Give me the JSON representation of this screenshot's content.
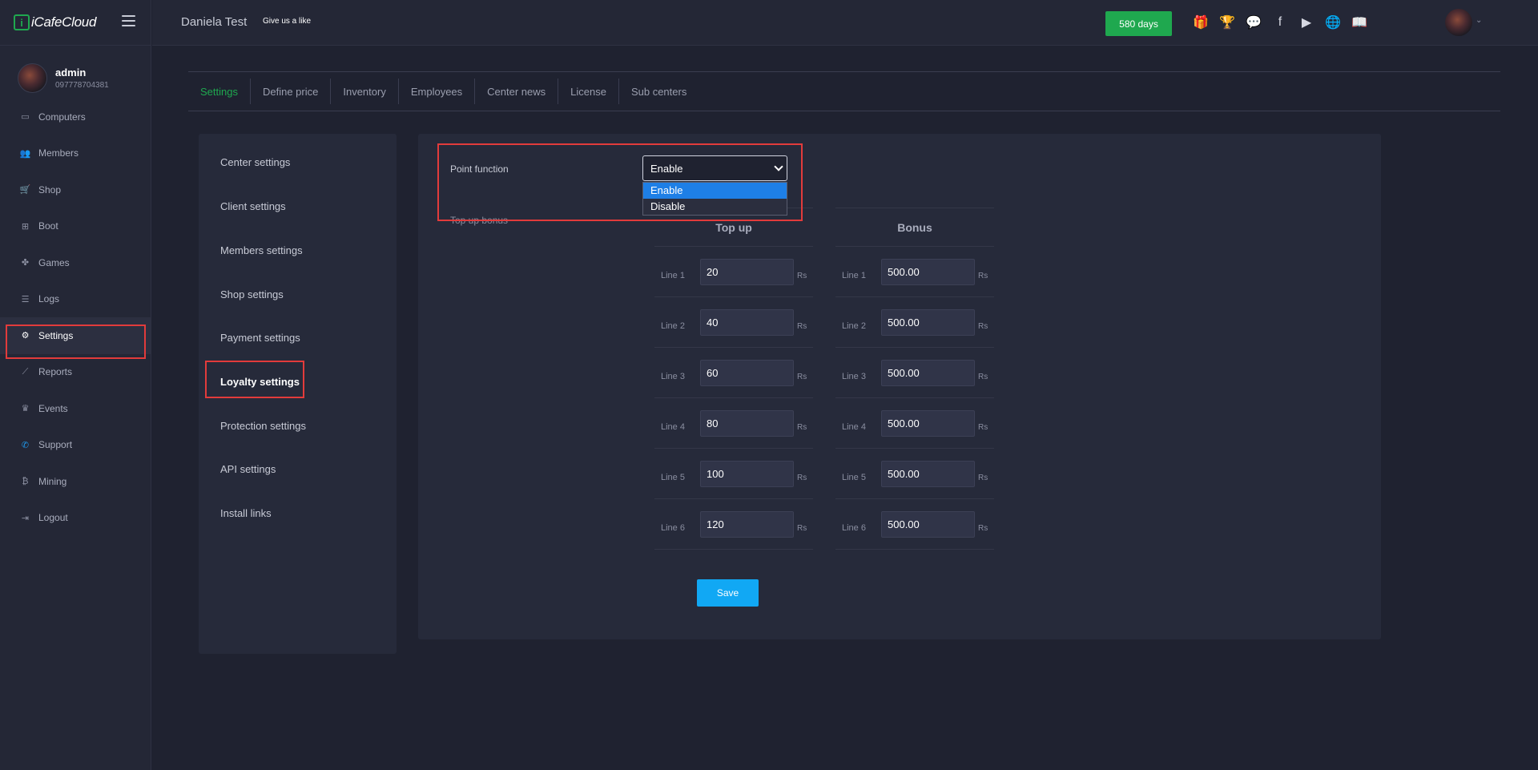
{
  "app": {
    "logo_text": "iCafeCloud",
    "logo_mark": "i"
  },
  "user": {
    "name": "admin",
    "phone": "097778704381"
  },
  "sidebar": {
    "items": [
      {
        "label": "Computers",
        "icon": "monitor-icon",
        "glyph": "▭"
      },
      {
        "label": "Members",
        "icon": "users-icon",
        "glyph": "👥"
      },
      {
        "label": "Shop",
        "icon": "cart-icon",
        "glyph": "🛒"
      },
      {
        "label": "Boot",
        "icon": "windows-icon",
        "glyph": "⊞"
      },
      {
        "label": "Games",
        "icon": "gamepad-icon",
        "glyph": "✤"
      },
      {
        "label": "Logs",
        "icon": "list-icon",
        "glyph": "☰"
      },
      {
        "label": "Settings",
        "icon": "gear-icon",
        "glyph": "⚙"
      },
      {
        "label": "Reports",
        "icon": "chart-icon",
        "glyph": "⟋"
      },
      {
        "label": "Events",
        "icon": "crown-icon",
        "glyph": "♛"
      },
      {
        "label": "Support",
        "icon": "phone-icon",
        "glyph": "✆"
      },
      {
        "label": "Mining",
        "icon": "bitcoin-icon",
        "glyph": "₿"
      },
      {
        "label": "Logout",
        "icon": "logout-icon",
        "glyph": "⇥"
      }
    ],
    "active_index": 6
  },
  "header": {
    "center_name": "Daniela Test",
    "give_like": "Give us a like",
    "days_badge": "580 days",
    "icons": [
      {
        "name": "gift-icon",
        "glyph": "🎁"
      },
      {
        "name": "trophy-icon",
        "glyph": "🏆"
      },
      {
        "name": "discord-icon",
        "glyph": "💬"
      },
      {
        "name": "facebook-icon",
        "glyph": "f"
      },
      {
        "name": "youtube-icon",
        "glyph": "▶"
      },
      {
        "name": "globe-icon",
        "glyph": "🌐"
      },
      {
        "name": "book-icon",
        "glyph": "📖"
      }
    ]
  },
  "tabs": [
    {
      "label": "Settings",
      "active": true
    },
    {
      "label": "Define price"
    },
    {
      "label": "Inventory"
    },
    {
      "label": "Employees"
    },
    {
      "label": "Center news"
    },
    {
      "label": "License"
    },
    {
      "label": "Sub centers"
    }
  ],
  "settings_menu": [
    {
      "label": "Center settings"
    },
    {
      "label": "Client settings"
    },
    {
      "label": "Members settings"
    },
    {
      "label": "Shop settings"
    },
    {
      "label": "Payment settings"
    },
    {
      "label": "Loyalty settings",
      "active": true
    },
    {
      "label": "Protection settings"
    },
    {
      "label": "API settings"
    },
    {
      "label": "Install links"
    }
  ],
  "loyalty": {
    "point_function_label": "Point function",
    "point_function_value": "Enable",
    "options": [
      "Enable",
      "Disable"
    ],
    "selected_option": "Enable",
    "topup_bonus_label": "Top up bonus",
    "topup_header": "Top up",
    "bonus_header": "Bonus",
    "unit": "Rs",
    "lines": [
      {
        "label": "Line 1",
        "topup": "20",
        "bonus": "500.00"
      },
      {
        "label": "Line 2",
        "topup": "40",
        "bonus": "500.00"
      },
      {
        "label": "Line 3",
        "topup": "60",
        "bonus": "500.00"
      },
      {
        "label": "Line 4",
        "topup": "80",
        "bonus": "500.00"
      },
      {
        "label": "Line 5",
        "topup": "100",
        "bonus": "500.00"
      },
      {
        "label": "Line 6",
        "topup": "120",
        "bonus": "500.00"
      }
    ],
    "save_label": "Save"
  },
  "colors": {
    "accent_green": "#1fa84f",
    "accent_blue": "#11a8f4",
    "highlight_red": "#e23b3b"
  }
}
